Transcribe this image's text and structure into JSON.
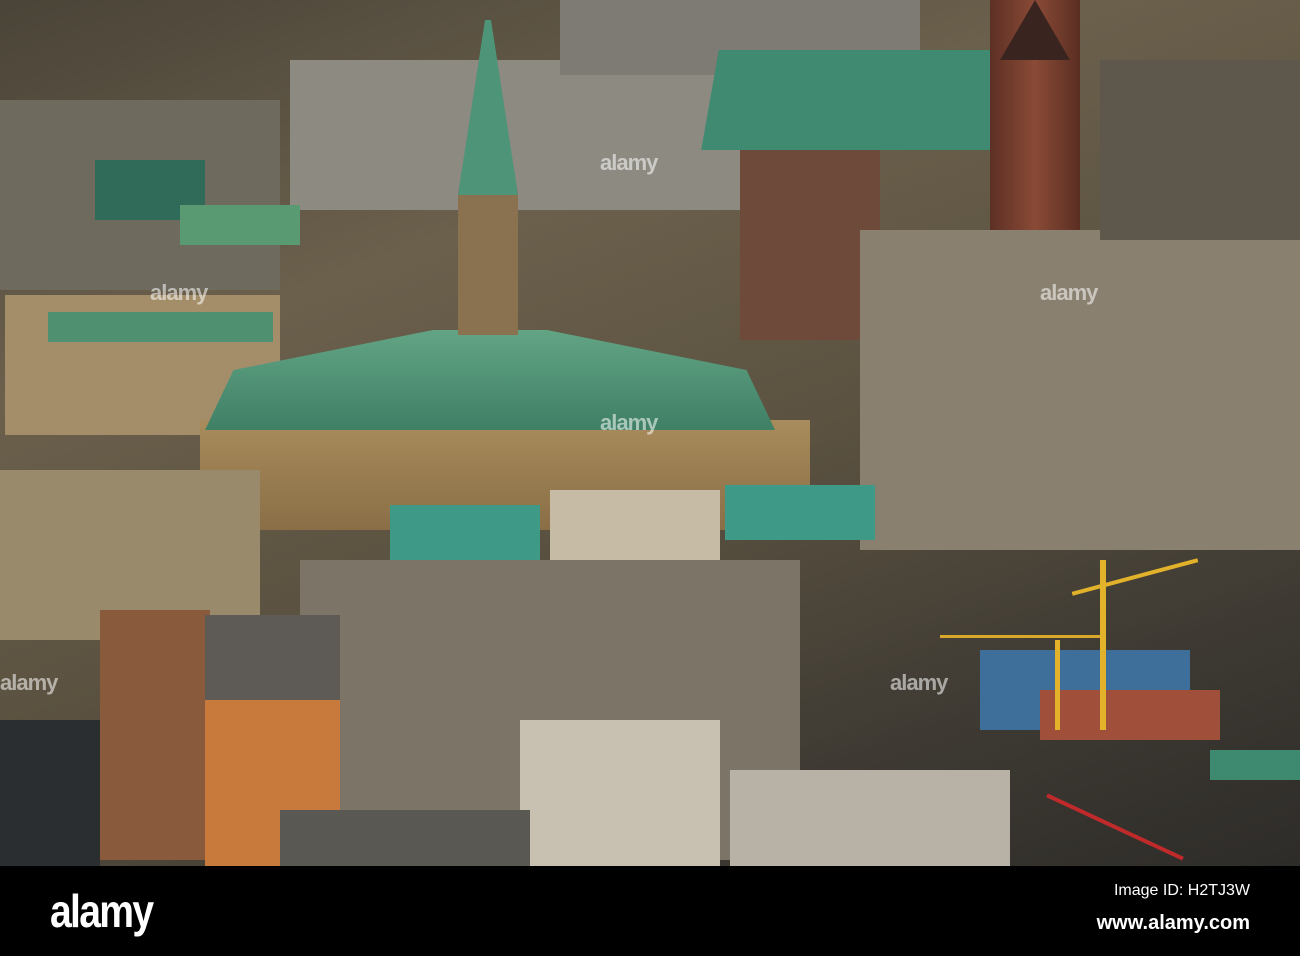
{
  "photo": {
    "subject": "Aerial view of a city center with a town hall with green copper roofs",
    "colors": {
      "copper_roof": "#4f9a7c",
      "stone": "#9c845c",
      "brick_tower": "#6a3a2c",
      "orange_building": "#c77a3c",
      "crane": "#e2b22a"
    }
  },
  "watermark": {
    "text": "alamy"
  },
  "footer": {
    "logo": "alamy",
    "image_id": "Image ID: H2TJ3W",
    "website": "www.alamy.com"
  }
}
